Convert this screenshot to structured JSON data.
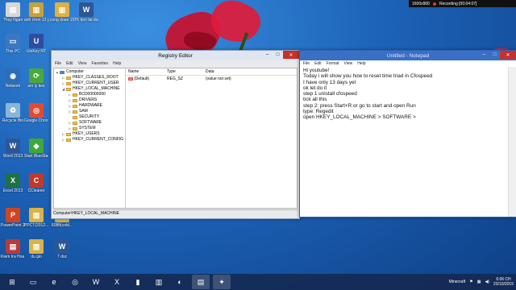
{
  "recording": {
    "resolution": "1600x900",
    "status": "Recording [00:04:07]"
  },
  "desktop_icons": [
    {
      "label": "Thuy Ngan",
      "color": "#d7d7d7",
      "glyph": "▤"
    },
    {
      "label": "anh chon 12 phuong",
      "color": "#c9a03c",
      "glyph": "▥"
    },
    {
      "label": "cong doan 15-16",
      "color": "#e0b040",
      "glyph": "▥"
    },
    {
      "label": "TK tien tai don gian doc",
      "color": "#2b5797",
      "glyph": "W"
    },
    {
      "label": "This PC",
      "color": "#3b78c2",
      "glyph": "▭"
    },
    {
      "label": "UniKey NT",
      "color": "#2e4d9f",
      "glyph": "U"
    },
    {
      "label": "Network",
      "color": "#2c6db7",
      "glyph": "◉"
    },
    {
      "label": "am ly tiee",
      "color": "#4aa93a",
      "glyph": "⟳"
    },
    {
      "label": "Recycle Bin",
      "color": "#8ab6d6",
      "glyph": "♻"
    },
    {
      "label": "Google Chrome",
      "color": "#e24a33",
      "glyph": "◎"
    },
    {
      "label": "Word 2013",
      "color": "#2b5797",
      "glyph": "W"
    },
    {
      "label": "Start BlueStacks",
      "color": "#3ea83a",
      "glyph": "◆"
    },
    {
      "label": "Excel 2013",
      "color": "#1e7145",
      "glyph": "X"
    },
    {
      "label": "CCleaner",
      "color": "#c0392b",
      "glyph": "C"
    },
    {
      "label": "PowerPoint 2013",
      "color": "#d04423",
      "glyph": "P"
    },
    {
      "label": "PPCT(2012...",
      "color": "#d9b24a",
      "glyph": "▥"
    },
    {
      "label": "608ft(cold...",
      "color": "#d9b24a",
      "glyph": "▥"
    },
    {
      "label": "Kiem tra Hoa 9 ket 10 tiet",
      "color": "#b83b3b",
      "glyph": "▤"
    },
    {
      "label": "du gio",
      "color": "#d9b24a",
      "glyph": "▥"
    },
    {
      "label": "7 doc",
      "color": "#2b5797",
      "glyph": "W"
    }
  ],
  "regedit": {
    "title": "Registry Editor",
    "menu": [
      "File",
      "Edit",
      "View",
      "Favorites",
      "Help"
    ],
    "tree": [
      {
        "label": "Computer",
        "level": 0,
        "icon": "computer",
        "expander": "▲"
      },
      {
        "label": "HKEY_CLASSES_ROOT",
        "level": 1,
        "icon": "folder",
        "expander": "▷"
      },
      {
        "label": "HKEY_CURRENT_USER",
        "level": 1,
        "icon": "folder",
        "expander": "▷"
      },
      {
        "label": "HKEY_LOCAL_MACHINE",
        "level": 1,
        "icon": "folder",
        "expander": "◢"
      },
      {
        "label": "BCD00000000",
        "level": 2,
        "icon": "folder",
        "expander": "▷"
      },
      {
        "label": "DRIVERS",
        "level": 2,
        "icon": "folder",
        "expander": "▷"
      },
      {
        "label": "HARDWARE",
        "level": 2,
        "icon": "folder",
        "expander": "▷"
      },
      {
        "label": "SAM",
        "level": 2,
        "icon": "folder",
        "expander": "▷"
      },
      {
        "label": "SECURITY",
        "level": 2,
        "icon": "folder",
        "expander": ""
      },
      {
        "label": "SOFTWARE",
        "level": 2,
        "icon": "folder",
        "expander": "▷"
      },
      {
        "label": "SYSTEM",
        "level": 2,
        "icon": "folder",
        "expander": "▷"
      },
      {
        "label": "HKEY_USERS",
        "level": 1,
        "icon": "folder",
        "expander": "▷"
      },
      {
        "label": "HKEY_CURRENT_CONFIG",
        "level": 1,
        "icon": "folder",
        "expander": "▷"
      }
    ],
    "columns": [
      "Name",
      "Type",
      "Data"
    ],
    "values": [
      {
        "name": "(Default)",
        "type": "REG_SZ",
        "data": "(value not set)"
      }
    ],
    "status_path": "Computer\\HKEY_LOCAL_MACHINE"
  },
  "notepad": {
    "title": "Untitled - Notepad",
    "menu": [
      "File",
      "Edit",
      "Format",
      "View",
      "Help"
    ],
    "lines": [
      "Hi youtube!",
      "Today i will show you how to reset time triad in Cfospeed",
      "I have only 13 days yet",
      "ok let do it",
      "step 1 unistall cfospeed",
      "tick all this",
      "step 2: press Start+R or go to start and open Run",
      "type: Regedit",
      "open HKEY_LOCAL_MACHINE > SOFTWARE >"
    ]
  },
  "taskbar": {
    "apps": [
      {
        "name": "start",
        "glyph": "⊞",
        "active": false
      },
      {
        "name": "file-explorer",
        "glyph": "▭",
        "active": false
      },
      {
        "name": "internet-explorer",
        "glyph": "e",
        "active": false
      },
      {
        "name": "chrome",
        "glyph": "◎",
        "active": false
      },
      {
        "name": "word",
        "glyph": "W",
        "active": false
      },
      {
        "name": "excel",
        "glyph": "X",
        "active": false
      },
      {
        "name": "cmd",
        "glyph": "▮",
        "active": false
      },
      {
        "name": "folder",
        "glyph": "▥",
        "active": false
      },
      {
        "name": "app",
        "glyph": "◐",
        "active": false
      },
      {
        "name": "notepad",
        "glyph": "▤",
        "active": true
      },
      {
        "name": "regedit",
        "glyph": "✦",
        "active": true
      }
    ],
    "tray_app": "Minecraft",
    "time": "6:06 CH",
    "date": "23/10/2015"
  },
  "colors": {
    "notepad_title": "#3a6fc6",
    "close_button": "#c7302b"
  }
}
